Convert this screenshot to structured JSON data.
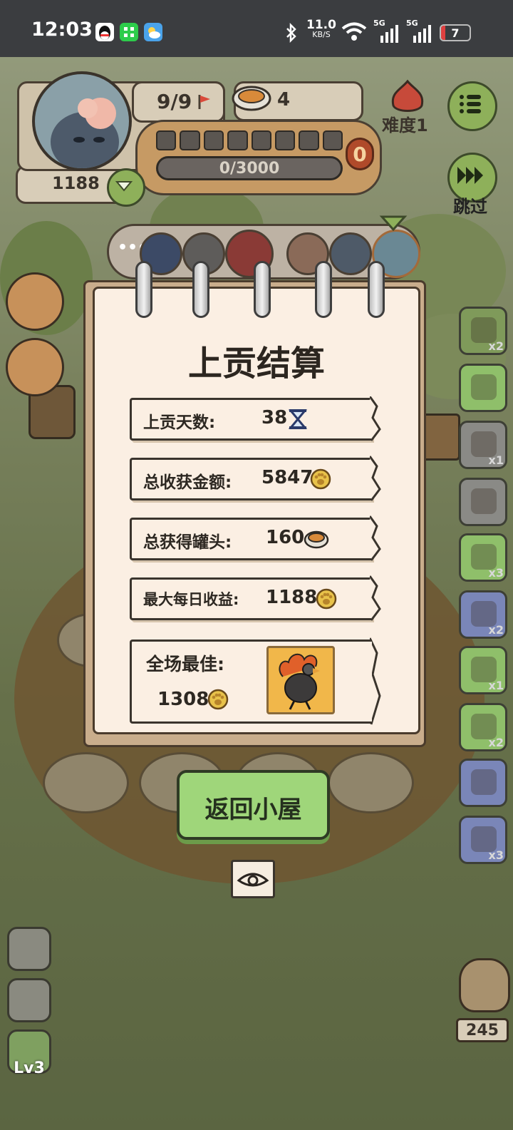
{
  "status_bar": {
    "time": "12:03",
    "net_speed": "11.0",
    "net_speed_unit": "KB/S",
    "signal1": "5G",
    "signal2": "5G",
    "battery": "7",
    "battery_level": 0.07
  },
  "hud": {
    "cats_count": "9/9",
    "cans": "4",
    "progress": "0/3000",
    "progress_fraction": 0,
    "badge": "0",
    "coins": "1188",
    "difficulty": "难度1",
    "skip_label": "跳过"
  },
  "notebook": {
    "title": "上贡结算",
    "rows": [
      {
        "label": "上贡天数:",
        "value": "38",
        "icon": "hourglass-icon"
      },
      {
        "label": "总收获金额:",
        "value": "5847",
        "icon": "paw-coin-icon"
      },
      {
        "label": "总获得罐头:",
        "value": "160",
        "icon": "can-icon"
      },
      {
        "label": "最大每日收益:",
        "value": "1188",
        "icon": "paw-coin-icon"
      }
    ],
    "best_label": "全场最佳:",
    "best_value": "1308"
  },
  "buttons": {
    "return_home": "返回小屋"
  },
  "side_items": [
    {
      "count": "x2"
    },
    {
      "count": ""
    },
    {
      "count": "x1"
    },
    {
      "count": ""
    },
    {
      "count": "x3"
    },
    {
      "count": "x2"
    },
    {
      "count": "x1"
    },
    {
      "count": "x2"
    },
    {
      "count": ""
    },
    {
      "count": "x3"
    }
  ],
  "bottom": {
    "level": "Lv3",
    "owl_count": "245"
  },
  "colors": {
    "accent_green": "#9fd67a",
    "paper": "#fbefe3",
    "coin": "#e8c24a"
  }
}
